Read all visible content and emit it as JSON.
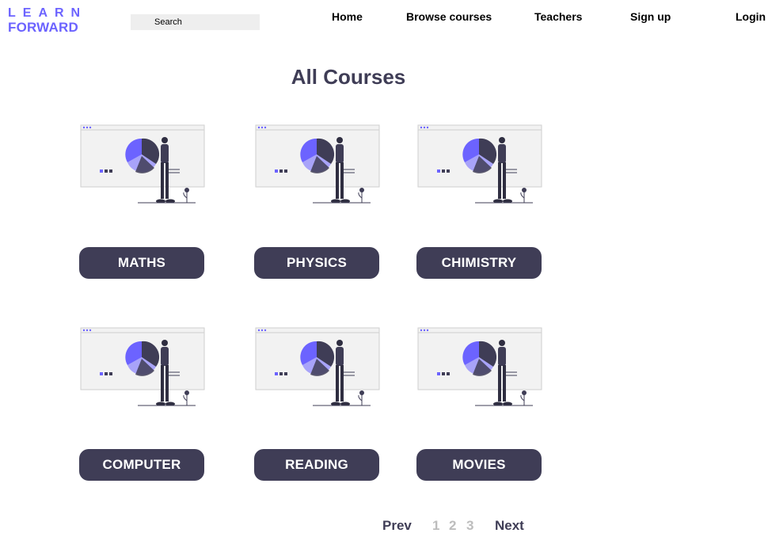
{
  "header": {
    "logo_top": "LEARN",
    "logo_bottom": "FORWARD",
    "search_placeholder": "Search",
    "nav": [
      "Home",
      "Browse courses",
      "Teachers",
      "Sign up",
      "Login"
    ]
  },
  "main": {
    "title": "All Courses",
    "courses": [
      "MATHS",
      "PHYSICS",
      "CHIMISTRY",
      "COMPUTER",
      "READING",
      "MOVIES"
    ]
  },
  "pagination": {
    "prev": "Prev",
    "pages": [
      "1",
      "2",
      "3"
    ],
    "next": "Next"
  },
  "colors": {
    "accent": "#6c63ff",
    "dark": "#3f3d56",
    "panel": "#f2f2f2"
  },
  "icons": {
    "course_illustration": "presentation-chart-illustration"
  }
}
